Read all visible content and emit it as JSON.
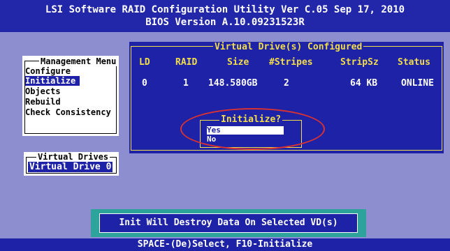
{
  "header": {
    "title": "LSI Software RAID Configuration Utility Ver C.05 Sep 17, 2010",
    "bios": "BIOS Version   A.10.09231523R"
  },
  "management_menu": {
    "title": "Management Menu",
    "items": [
      "Configure",
      "Initialize",
      "Objects",
      "Rebuild",
      "Check Consistency"
    ],
    "selected": "Initialize"
  },
  "vd_configured": {
    "title": "Virtual Drive(s) Configured",
    "columns": [
      "LD",
      "RAID",
      "Size",
      "#Stripes",
      "StripSz",
      "Status"
    ],
    "rows": [
      {
        "ld": "0",
        "raid": "1",
        "size": "148.580GB",
        "stripes": "2",
        "stripsz": "64 KB",
        "status": "ONLINE"
      }
    ]
  },
  "initialize_dialog": {
    "title": "Initialize?",
    "options": [
      "Yes",
      "No"
    ],
    "selected": "Yes"
  },
  "virtual_drives": {
    "title": "Virtual Drives",
    "items": [
      "Virtual Drive 0"
    ]
  },
  "message": "Init Will Destroy Data On Selected VD(s)",
  "footer": "SPACE-(De)Select,  F10-Initialize",
  "colors": {
    "background": "#8c8ed0",
    "panel": "#1d22a6",
    "accent_yellow": "#f3dd4a",
    "highlight_red": "#d83232",
    "message_border": "#2ea39c"
  }
}
